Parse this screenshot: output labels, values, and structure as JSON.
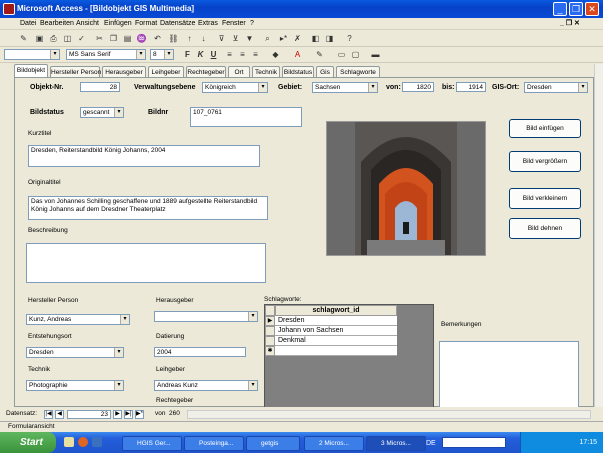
{
  "window": {
    "title": "Microsoft Access - [Bildobjekt GIS Multimedia]"
  },
  "menu": [
    "Datei",
    "Bearbeiten",
    "Ansicht",
    "Einfügen",
    "Format",
    "Datensätze",
    "Extras",
    "Fenster",
    "?"
  ],
  "format_toolbar": {
    "font": "MS Sans Serif",
    "size": "8"
  },
  "tabs": [
    "Bildobjekt",
    "Hersteller Person",
    "Herausgeber",
    "Leihgeber",
    "Rechtegeber",
    "Ort",
    "Technik",
    "Bildstatus",
    "Gis",
    "Schlagworte"
  ],
  "form": {
    "objekt_nr_label": "Objekt-Nr.",
    "objekt_nr_value": "28",
    "verwaltungsebene_label": "Verwaltungsebene",
    "verwaltungsebene_value": "Königreich",
    "gebiet_label": "Gebiet:",
    "gebiet_value": "Sachsen",
    "von_label": "von:",
    "von_value": "1820",
    "bis_label": "bis:",
    "bis_value": "1914",
    "gis_ort_label": "GIS-Ort:",
    "gis_ort_value": "Dresden",
    "bildstatus_label": "Bildstatus",
    "bildstatus_value": "gescannt",
    "bildnr_label": "Bildnr",
    "bildnr_value": "107_0761",
    "kurztitel_label": "Kurztitel",
    "kurztitel_value": "Dresden, Reiterstandbild König Johanns, 2004",
    "originaltitel_label": "Originaltitel",
    "originaltitel_value": "Das von Johannes Schilling geschaffene und 1889 aufgestellte Reiterstandbild König Johanns auf dem Dresdner Theaterplatz",
    "beschreibung_label": "Beschreibung",
    "beschreibung_value": "",
    "hersteller_label": "Hersteller Person",
    "hersteller_value": "Kunz, Andreas",
    "herausgeber_label": "Herausgeber",
    "herausgeber_value": "",
    "entstehungsort_label": "Entstehungsort",
    "entstehungsort_value": "Dresden",
    "datierung_label": "Datierung",
    "datierung_value": "2004",
    "technik_label": "Technik",
    "technik_value": "Photographie",
    "leihgeber_label": "Leihgeber",
    "leihgeber_value": "Andreas Kunz",
    "rechtegeber_label": "Rechtegeber",
    "schlagworte_label": "Schlagworte:",
    "bemerkungen_label": "Bemerkungen"
  },
  "buttons": {
    "bild_einfuegen": "Bild einfügen",
    "bild_vergroessern": "Bild vergrößern",
    "bild_verkleinern": "Bild verkleinern",
    "bild_dehnen": "Bild dehnen"
  },
  "schlagwort_grid": {
    "header": "schlagwort_id",
    "rows": [
      "Dresden",
      "Johann von Sachsen",
      "Denkmal"
    ]
  },
  "navigation": {
    "label": "Datensatz:",
    "current": "23",
    "of_label": "von",
    "total": "260"
  },
  "statusbar": {
    "text": "Formularansicht"
  },
  "taskbar": {
    "start": "Start",
    "tasks": [
      "HGIS Ger...",
      "Posteinga...",
      "getgis",
      "2 Micros...",
      "3 Micros..."
    ],
    "lang": "DE",
    "clock": "17:15"
  }
}
